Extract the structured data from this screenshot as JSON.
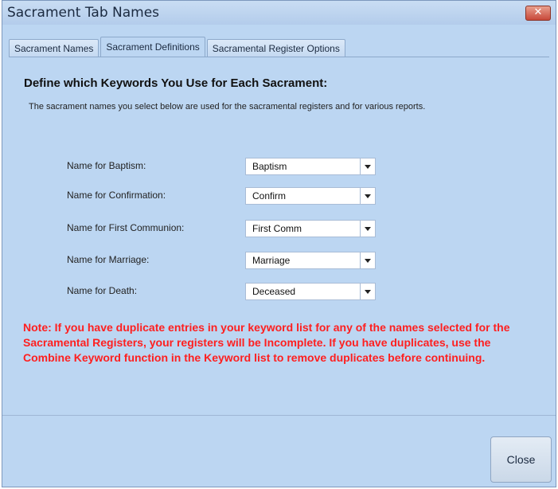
{
  "window": {
    "title": "Sacrament Tab Names",
    "close_glyph": "✕"
  },
  "tabs": [
    {
      "label": "Sacrament Names",
      "active": false
    },
    {
      "label": "Sacrament Definitions",
      "active": true
    },
    {
      "label": "Sacramental Register Options",
      "active": false
    }
  ],
  "main": {
    "heading": "Define which Keywords You Use for Each Sacrament:",
    "description": "The sacrament names you select below are used for the sacramental registers and for various reports.",
    "fields": [
      {
        "label": "Name for Baptism:",
        "value": "Baptism"
      },
      {
        "label": "Name for Confirmation:",
        "value": "Confirm"
      },
      {
        "label": "Name for First Communion:",
        "value": "First Comm"
      },
      {
        "label": "Name for Marriage:",
        "value": "Marriage"
      },
      {
        "label": "Name for Death:",
        "value": "Deceased"
      }
    ],
    "note": "Note: If you have duplicate entries in your keyword list for any of the names selected for the Sacramental Registers, your registers will be Incomplete. If you have duplicates, use the Combine Keyword function in the Keyword list to remove duplicates before continuing."
  },
  "footer": {
    "close_label": "Close"
  },
  "colors": {
    "window_bg": "#bcd6f2",
    "note_text": "#ff1f1f",
    "close_x_bg": "#c8483a"
  },
  "icons": {
    "window_close": "close-icon",
    "dropdown": "chevron-down-icon"
  }
}
